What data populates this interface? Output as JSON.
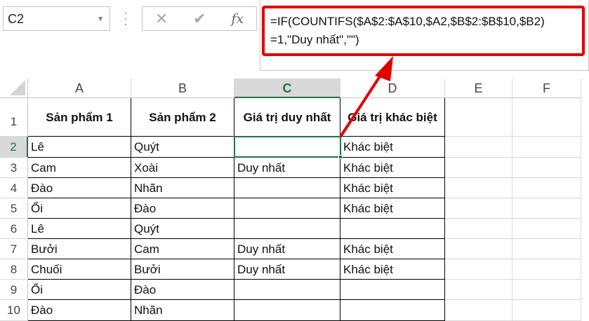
{
  "name_box": "C2",
  "formula_buttons": {
    "cancel": "✕",
    "enter": "✔",
    "fx": "fx"
  },
  "formula": "=IF(COUNTIFS($A$2:$A$10,$A2,$B$2:$B$10,$B2)\n=1,\"Duy nhất\",\"\")",
  "columns": [
    "A",
    "B",
    "C",
    "D",
    "E",
    "F"
  ],
  "selected_column": "C",
  "headers": [
    "Sản phẩm 1",
    "Sản phẩm 2",
    "Giá trị duy nhất",
    "Giá trị khác biệt"
  ],
  "rows": [
    [
      "Lê",
      "Quýt",
      "",
      "Khác biệt"
    ],
    [
      "Cam",
      "Xoài",
      "Duy nhất",
      "Khác biệt"
    ],
    [
      "Đào",
      "Nhãn",
      "",
      "Khác biệt"
    ],
    [
      "Ổi",
      "Đào",
      "",
      "Khác biệt"
    ],
    [
      "Lê",
      "Quýt",
      "",
      ""
    ],
    [
      "Bưởi",
      "Cam",
      "Duy nhất",
      "Khác biệt"
    ],
    [
      "Chuối",
      "Bưởi",
      "Duy nhất",
      "Khác biệt"
    ],
    [
      "Ổi",
      "Đào",
      "",
      ""
    ],
    [
      "Đào",
      "Nhãn",
      "",
      ""
    ]
  ],
  "annotation_color": "#e00000"
}
